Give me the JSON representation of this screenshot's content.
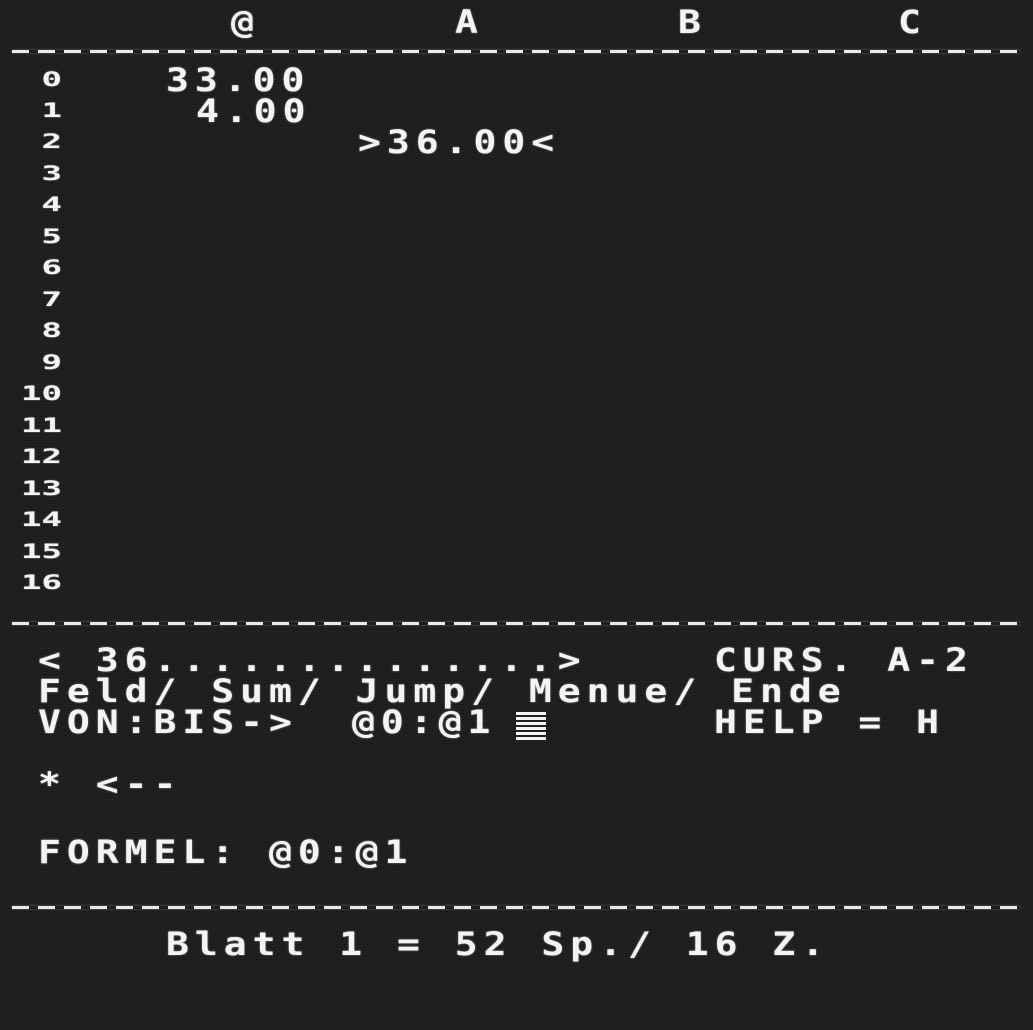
{
  "columns": [
    "@",
    "A",
    "B",
    "C"
  ],
  "rows": [
    "0",
    "1",
    "2",
    "3",
    "4",
    "5",
    "6",
    "7",
    "8",
    "9",
    "10",
    "11",
    "12",
    "13",
    "14",
    "15",
    "16"
  ],
  "cells": [
    {
      "ref": "@0",
      "value": "33.00"
    },
    {
      "ref": "@1",
      "value": "4.00"
    },
    {
      "ref": "A2",
      "value": ">36.00<",
      "selected": true
    }
  ],
  "status": {
    "preview": "< 36..............>",
    "cursor": "CURS. A-2",
    "menu": "Feld/ Sum/ Jump/ Menue/ Ende",
    "range_label": "VON:BIS->",
    "range_value": "@0:@1",
    "help": "HELP = H",
    "pointer": "* <--",
    "formula": "FORMEL: @0:@1"
  },
  "footer": {
    "sheet_info": "Blatt 1 = 52 Sp./ 16 Z."
  },
  "colors": {
    "background": "#202020",
    "text": "#f4f4f4"
  }
}
